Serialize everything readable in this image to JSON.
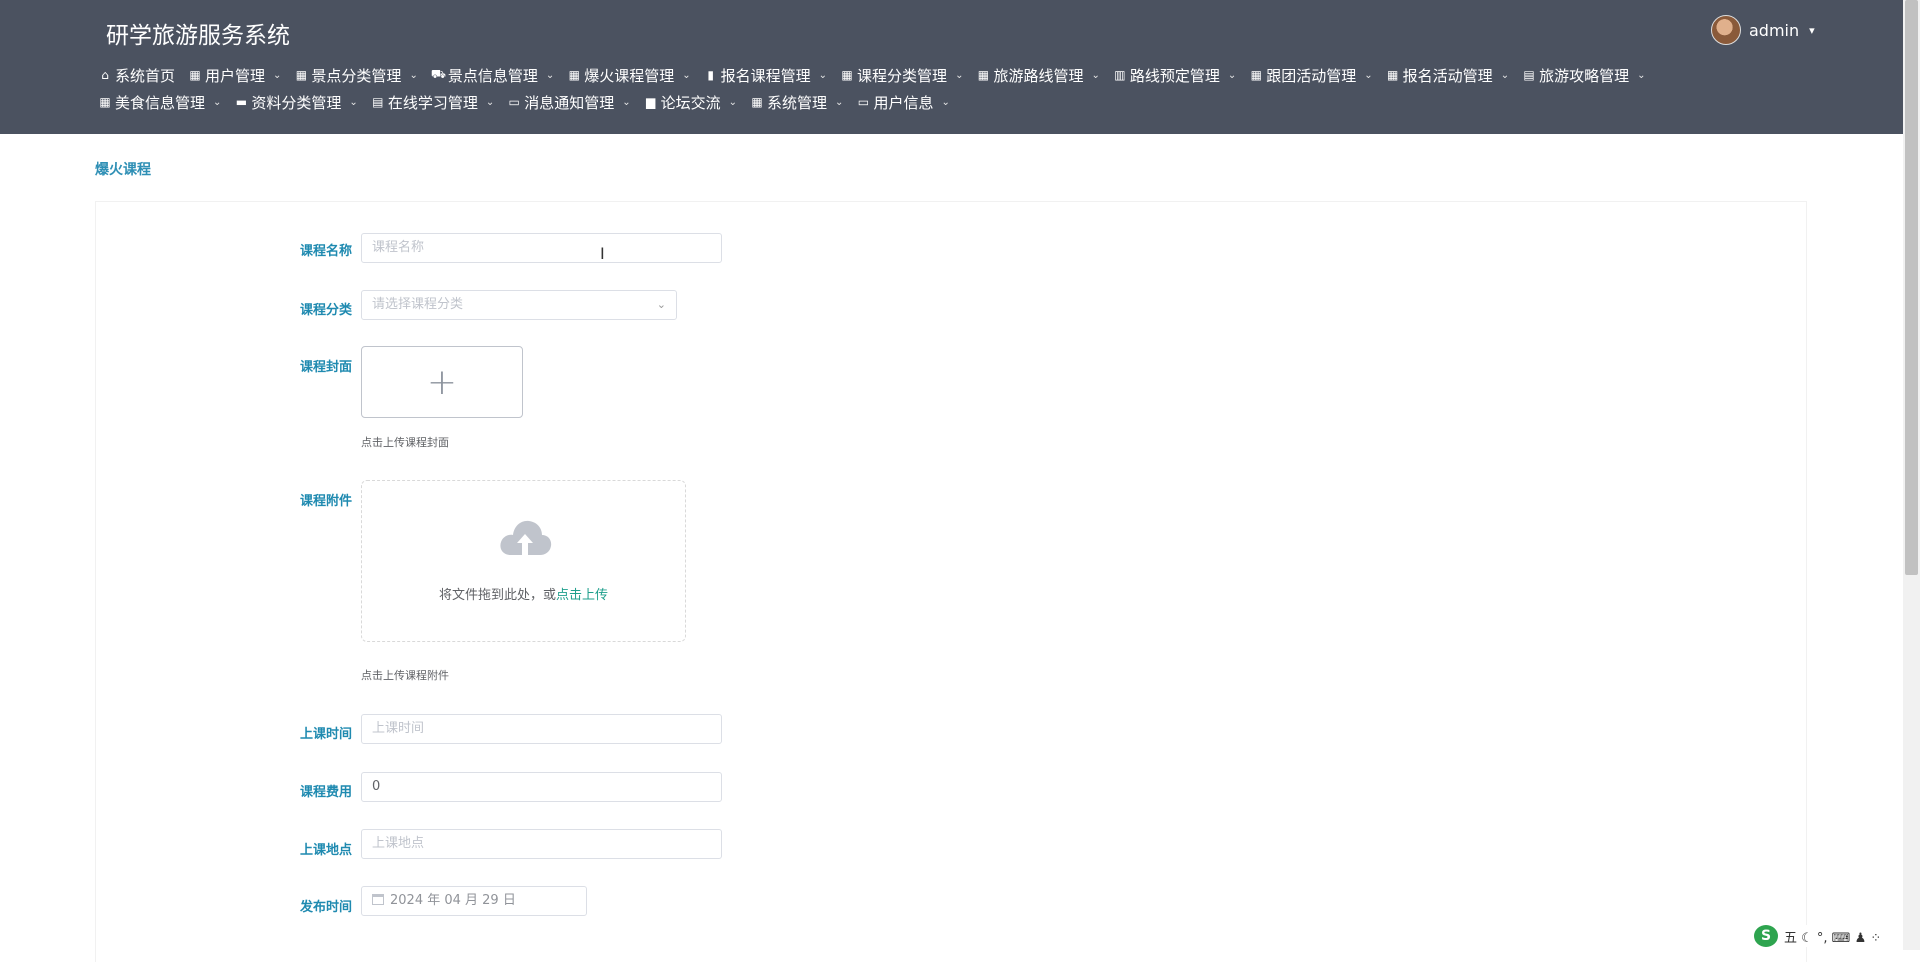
{
  "header": {
    "title": "研学旅游服务系统",
    "user": "admin",
    "caret": "▾"
  },
  "nav": {
    "row1": [
      {
        "label": "系统首页",
        "icon": "home-icon",
        "glyph": "⌂",
        "dropdown": false
      },
      {
        "label": "用户管理",
        "icon": "grid-icon",
        "glyph": "▦",
        "dropdown": true
      },
      {
        "label": "景点分类管理",
        "icon": "grid-icon",
        "glyph": "▦",
        "dropdown": true
      },
      {
        "label": "景点信息管理",
        "icon": "ticket-icon",
        "glyph": "⛟",
        "dropdown": true
      },
      {
        "label": "爆火课程管理",
        "icon": "grid-icon",
        "glyph": "▦",
        "dropdown": true
      },
      {
        "label": "报名课程管理",
        "icon": "card-icon",
        "glyph": "▮",
        "dropdown": true
      },
      {
        "label": "课程分类管理",
        "icon": "grid-icon",
        "glyph": "▦",
        "dropdown": true
      },
      {
        "label": "旅游路线管理",
        "icon": "grid-icon",
        "glyph": "▦",
        "dropdown": true
      },
      {
        "label": "路线预定管理",
        "icon": "book-icon",
        "glyph": "▥",
        "dropdown": true
      },
      {
        "label": "跟团活动管理",
        "icon": "grid-icon",
        "glyph": "▦",
        "dropdown": true
      },
      {
        "label": "报名活动管理",
        "icon": "grid-icon",
        "glyph": "▦",
        "dropdown": true
      },
      {
        "label": "旅游攻略管理",
        "icon": "clipboard-icon",
        "glyph": "▤",
        "dropdown": true
      }
    ],
    "row2": [
      {
        "label": "美食信息管理",
        "icon": "grid-icon",
        "glyph": "▦",
        "dropdown": true
      },
      {
        "label": "资料分类管理",
        "icon": "comment-icon",
        "glyph": "▬",
        "dropdown": true
      },
      {
        "label": "在线学习管理",
        "icon": "clipboard-icon",
        "glyph": "▤",
        "dropdown": true
      },
      {
        "label": "消息通知管理",
        "icon": "ticket-icon",
        "glyph": "▭",
        "dropdown": true
      },
      {
        "label": "论坛交流",
        "icon": "bar-chart-icon",
        "glyph": "▆",
        "dropdown": true
      },
      {
        "label": "系统管理",
        "icon": "grid-icon",
        "glyph": "▦",
        "dropdown": true
      },
      {
        "label": "用户信息",
        "icon": "card-icon",
        "glyph": "▭",
        "dropdown": true
      }
    ],
    "chevron": "⌄"
  },
  "breadcrumb": "爆火课程",
  "form": {
    "name": {
      "label": "课程名称",
      "placeholder": "课程名称"
    },
    "category": {
      "label": "课程分类",
      "placeholder": "请选择课程分类"
    },
    "cover": {
      "label": "课程封面",
      "tip": "点击上传课程封面",
      "plus": "+"
    },
    "attachment": {
      "label": "课程附件",
      "drag_text": "将文件拖到此处，或",
      "drag_link": "点击上传",
      "tip": "点击上传课程附件"
    },
    "time": {
      "label": "上课时间",
      "placeholder": "上课时间"
    },
    "fee": {
      "label": "课程费用",
      "value": "0"
    },
    "place": {
      "label": "上课地点",
      "placeholder": "上课地点"
    },
    "publish": {
      "label": "发布时间",
      "value": "2024 年 04 月 29 日"
    }
  },
  "ime": {
    "logo": "S",
    "items": "五 ☾ °, ⌨ ♟ ⁘"
  },
  "colors": {
    "header_bg": "#4b5260",
    "label": "#1f8ab0",
    "link": "#1f9f8c"
  }
}
